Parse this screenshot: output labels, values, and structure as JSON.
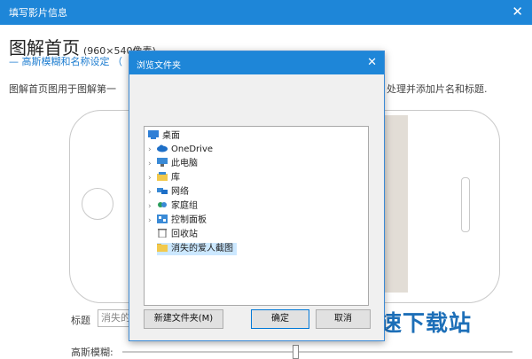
{
  "window": {
    "title": "填写影片信息",
    "close_icon": "✕"
  },
  "header": {
    "title": "图解首页",
    "dimensions": "(960×540像素)",
    "subtitle": "— 高斯模糊和名称设定 （"
  },
  "description": {
    "left": "图解首页图用于图解第一",
    "right": "处理并添加片名和标题."
  },
  "form": {
    "title_label": "标题",
    "title_value": "消失的",
    "blur_label": "高斯模糊:",
    "blur_level": 0.44
  },
  "watermark": "极速下载站",
  "dialog": {
    "title": "浏览文件夹",
    "close_icon": "✕",
    "tree": {
      "root": "桌面",
      "items": [
        {
          "label": "OneDrive",
          "icon": "cloud-icon",
          "expandable": true
        },
        {
          "label": "此电脑",
          "icon": "computer-icon",
          "expandable": true
        },
        {
          "label": "库",
          "icon": "library-icon",
          "expandable": true
        },
        {
          "label": "网络",
          "icon": "network-icon",
          "expandable": true
        },
        {
          "label": "家庭组",
          "icon": "homegroup-icon",
          "expandable": true
        },
        {
          "label": "控制面板",
          "icon": "control-panel-icon",
          "expandable": true
        },
        {
          "label": "回收站",
          "icon": "recycle-bin-icon",
          "expandable": false
        },
        {
          "label": "消失的爱人截图",
          "icon": "folder-icon",
          "expandable": false,
          "selected": true
        }
      ]
    },
    "buttons": {
      "new_folder": "新建文件夹(M)",
      "ok": "确定",
      "cancel": "取消"
    }
  },
  "colors": {
    "accent": "#1e86d8",
    "selection": "#cce8ff",
    "folder": "#f2c94c"
  }
}
